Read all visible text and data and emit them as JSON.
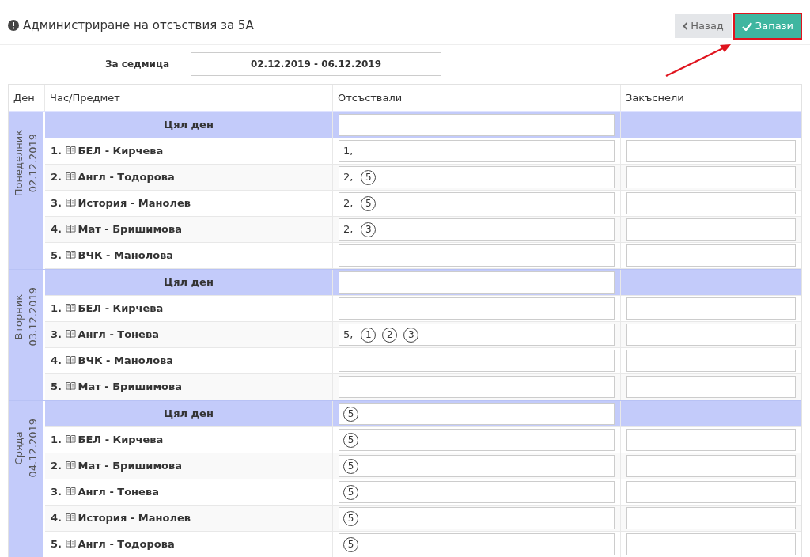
{
  "title": "Администриране на отсъствия за 5А",
  "back_button": {
    "label": "Назад"
  },
  "save_button": {
    "label": "Запази",
    "highlighted": true
  },
  "week": {
    "label": "За седмица",
    "value": "02.12.2019 - 06.12.2019"
  },
  "table": {
    "columns": [
      "Ден",
      "Час/Предмет",
      "Отсъствали",
      "Закъснели"
    ],
    "days": [
      {
        "name": "Понеделник",
        "date": "02.12.2019",
        "rows": [
          {
            "kind": "whole_day",
            "label": "Цял ден"
          },
          {
            "kind": "lesson",
            "label": "1. ",
            "subject": "БЕЛ - Кирчева",
            "absent": {
              "text": "1,"
            }
          },
          {
            "kind": "lesson",
            "label": "2. ",
            "subject": "Англ - Тодорова",
            "absent": {
              "text": "2,",
              "tags": [
                "5"
              ]
            }
          },
          {
            "kind": "lesson",
            "label": "3. ",
            "subject": "История - Манолев",
            "absent": {
              "text": "2,",
              "tags": [
                "5"
              ]
            }
          },
          {
            "kind": "lesson",
            "label": "4. ",
            "subject": "Мат - Бришимова",
            "absent": {
              "text": "2,",
              "tags": [
                "3"
              ]
            }
          },
          {
            "kind": "lesson",
            "label": "5. ",
            "subject": "ВЧК - Манолова"
          }
        ]
      },
      {
        "name": "Вторник",
        "date": "03.12.2019",
        "rows": [
          {
            "kind": "whole_day",
            "label": "Цял ден"
          },
          {
            "kind": "lesson",
            "label": "1. ",
            "subject": "БЕЛ - Кирчева"
          },
          {
            "kind": "lesson",
            "label": "3. ",
            "subject": "Англ - Тонева",
            "absent": {
              "text": "5,",
              "tags": [
                "1",
                "2",
                "3"
              ]
            }
          },
          {
            "kind": "lesson",
            "label": "4. ",
            "subject": "ВЧК - Манолова"
          },
          {
            "kind": "lesson",
            "label": "5. ",
            "subject": "Мат - Бришимова"
          }
        ]
      },
      {
        "name": "Сряда",
        "date": "04.12.2019",
        "rows": [
          {
            "kind": "whole_day",
            "label": "Цял ден",
            "absent": {
              "tags": [
                "5"
              ]
            }
          },
          {
            "kind": "lesson",
            "label": "1. ",
            "subject": "БЕЛ - Кирчева",
            "absent": {
              "tags": [
                "5"
              ]
            }
          },
          {
            "kind": "lesson",
            "label": "2. ",
            "subject": "Мат - Бришимова",
            "absent": {
              "tags": [
                "5"
              ]
            }
          },
          {
            "kind": "lesson",
            "label": "3. ",
            "subject": "Англ - Тонева",
            "absent": {
              "tags": [
                "5"
              ]
            }
          },
          {
            "kind": "lesson",
            "label": "4. ",
            "subject": "История - Манолев",
            "absent": {
              "tags": [
                "5"
              ]
            }
          },
          {
            "kind": "lesson",
            "label": "5. ",
            "subject": "Англ - Тодорова",
            "absent": {
              "tags": [
                "5"
              ]
            }
          }
        ]
      }
    ]
  }
}
